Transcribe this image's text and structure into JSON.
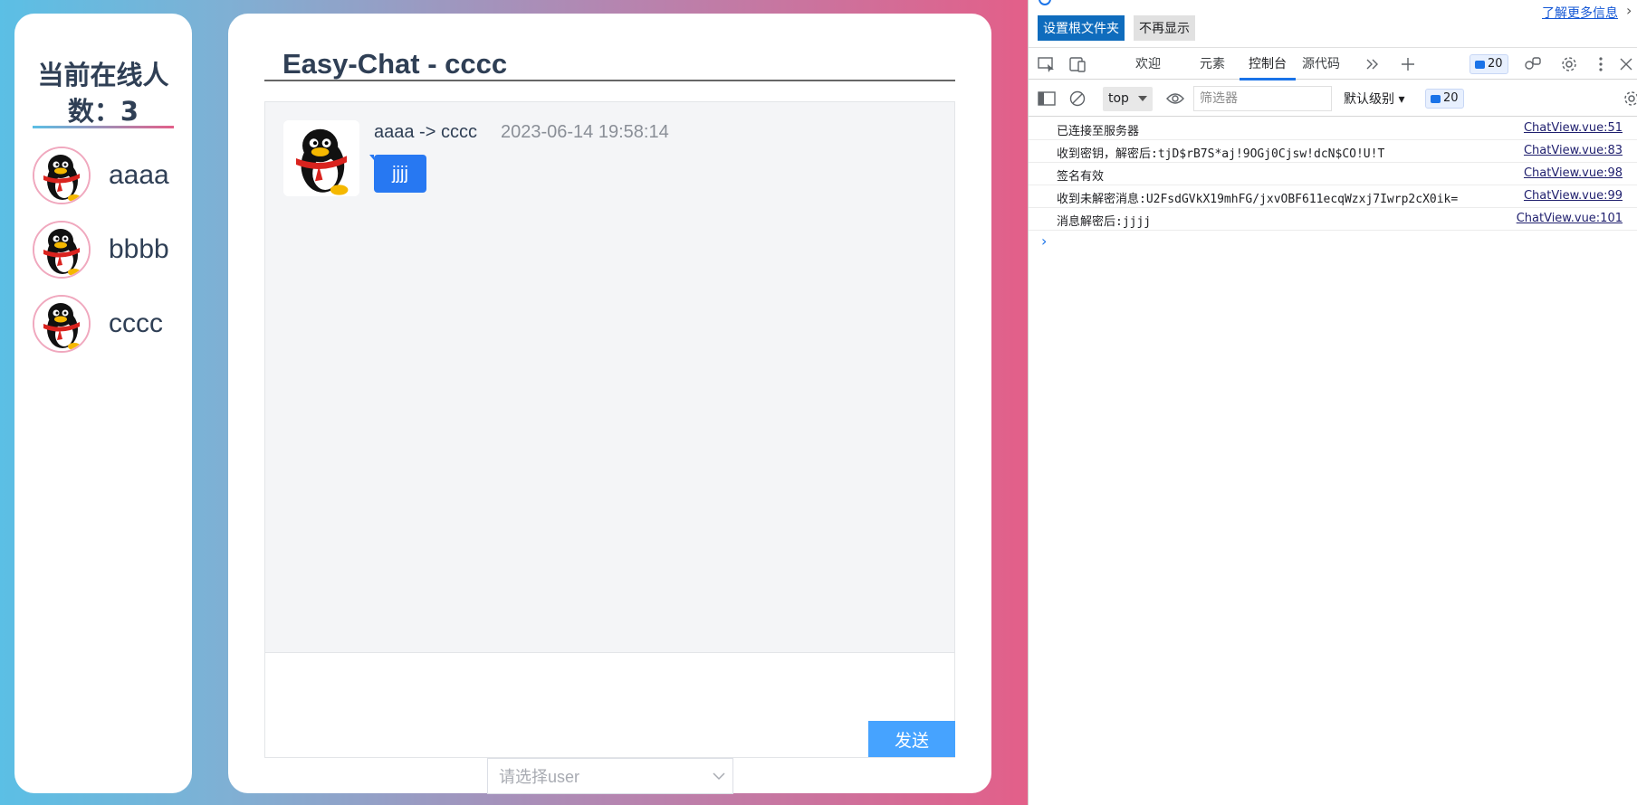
{
  "sidebar": {
    "title": "当前在线人数：3",
    "users": [
      {
        "name": "aaaa"
      },
      {
        "name": "bbbb"
      },
      {
        "name": "cccc"
      }
    ]
  },
  "chat": {
    "title": "Easy-Chat - cccc",
    "messages": [
      {
        "from": "aaaa -> cccc",
        "time": "2023-06-14 19:58:14",
        "text": "jjjj"
      }
    ],
    "send_label": "发送",
    "select_placeholder": "请选择user"
  },
  "devtools": {
    "infobar": {
      "set_root_label": "设置根文件夹",
      "dismiss_label": "不再显示",
      "learn_more_label": "了解更多信息"
    },
    "tabs": [
      "欢迎",
      "元素",
      "控制台",
      "源代码"
    ],
    "issues_count": "20",
    "context": "top",
    "filter_placeholder": "筛选器",
    "level_label": "默认级别",
    "messages_count": "20",
    "logs": [
      {
        "message": "已连接至服务器",
        "source": "ChatView.vue:51"
      },
      {
        "message": "收到密钥，解密后:tjD$rB7S*aj!9OGj0Cjsw!dcN$CO!U!T",
        "source": "ChatView.vue:83"
      },
      {
        "message": "签名有效",
        "source": "ChatView.vue:98"
      },
      {
        "message": "收到未解密消息:U2FsdGVkX19mhFG/jxvOBF611ecqWzxj7Iwrp2cX0ik=",
        "source": "ChatView.vue:99"
      },
      {
        "message": "消息解密后:jjjj",
        "source": "ChatView.vue:101"
      }
    ]
  }
}
